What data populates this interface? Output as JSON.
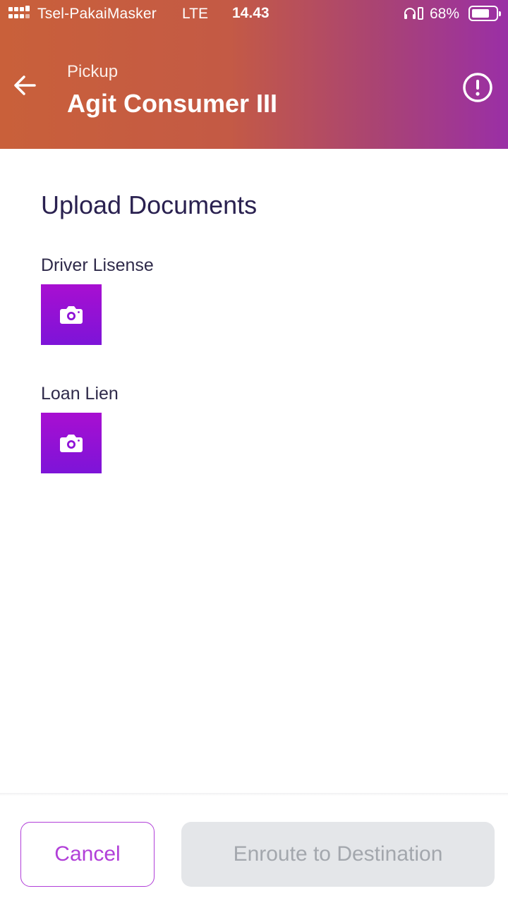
{
  "status_bar": {
    "carrier": "Tsel-PakaiMasker",
    "network": "LTE",
    "time": "14.43",
    "battery_percent": "68%",
    "battery_level": 0.68,
    "icons": [
      "signal-dots-icon",
      "headphones-icon",
      "battery-icon"
    ]
  },
  "header": {
    "subtitle": "Pickup",
    "title": "Agit Consumer III",
    "back_icon": "arrow-left-icon",
    "info_icon": "exclamation-circle-icon",
    "gradient": [
      "#c9603a",
      "#9a2fa6"
    ]
  },
  "main": {
    "section_title": "Upload Documents",
    "documents": [
      {
        "label": "Driver Lisense",
        "icon": "camera-icon"
      },
      {
        "label": "Loan Lien",
        "icon": "camera-icon"
      }
    ],
    "upload_color": "#8e12d6"
  },
  "footer": {
    "cancel_label": "Cancel",
    "enroute_label": "Enroute to Destination",
    "accent": "#b13fd8",
    "disabled_bg": "#e4e6e9"
  }
}
